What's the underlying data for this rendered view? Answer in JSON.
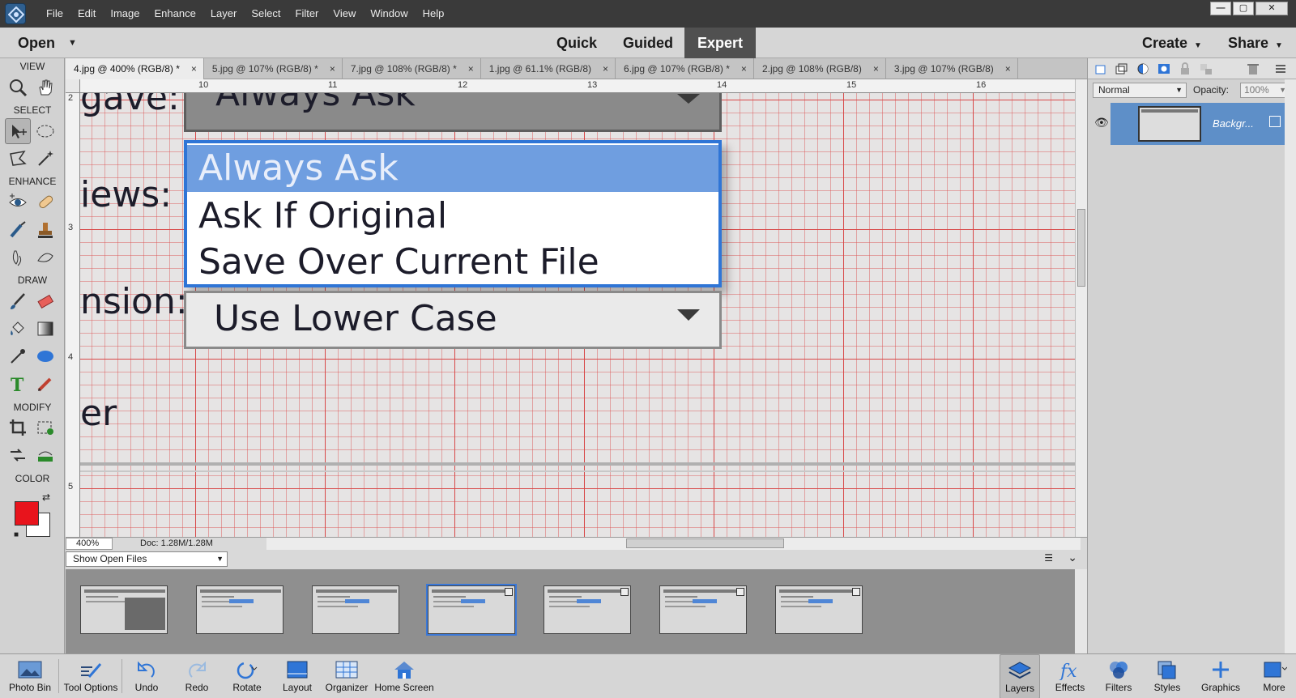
{
  "menubar": {
    "menus": [
      "File",
      "Edit",
      "Image",
      "Enhance",
      "Layer",
      "Select",
      "Filter",
      "View",
      "Window",
      "Help"
    ],
    "window_controls": [
      "—",
      "▢",
      "✕"
    ]
  },
  "modebar": {
    "open_label": "Open",
    "modes": [
      "Quick",
      "Guided",
      "Expert"
    ],
    "active_mode": "Expert",
    "create_label": "Create",
    "share_label": "Share"
  },
  "toolbox": {
    "sections": [
      "VIEW",
      "SELECT",
      "ENHANCE",
      "DRAW",
      "MODIFY",
      "COLOR"
    ],
    "foreground_color": "#e8141c",
    "background_color": "#ffffff"
  },
  "tabs": [
    {
      "label": "4.jpg @ 400% (RGB/8) *",
      "active": true
    },
    {
      "label": "5.jpg @ 107% (RGB/8) *",
      "active": false
    },
    {
      "label": "7.jpg @ 108% (RGB/8) *",
      "active": false
    },
    {
      "label": "1.jpg @ 61.1% (RGB/8)",
      "active": false
    },
    {
      "label": "6.jpg @ 107% (RGB/8) *",
      "active": false
    },
    {
      "label": "2.jpg @ 108% (RGB/8)",
      "active": false
    },
    {
      "label": "3.jpg @ 107% (RGB/8)",
      "active": false
    }
  ],
  "ruler": {
    "top_numbers": [
      "10",
      "11",
      "12",
      "13",
      "14",
      "15",
      "16"
    ],
    "left_numbers": [
      "2",
      "3",
      "4",
      "5"
    ]
  },
  "canvas": {
    "fragments": [
      "gave:",
      "iews:",
      "nsion:",
      "er"
    ],
    "combo_top_value": "Always Ask",
    "dropdown_items": [
      "Always Ask",
      "Ask If Original",
      "Save Over Current File"
    ],
    "combo_bottom_value": "Use Lower Case"
  },
  "status": {
    "zoom": "400%",
    "doc_info": "Doc: 1.28M/1.28M"
  },
  "photo_bin": {
    "show_label": "Show Open Files",
    "thumb_count": 7,
    "selected_index": 3
  },
  "layers_panel": {
    "blend_mode": "Normal",
    "opacity_label": "Opacity:",
    "opacity_value": "100%",
    "layer_name": "Backgr..."
  },
  "taskbar": {
    "left": [
      "Photo Bin",
      "Tool Options",
      "Undo",
      "Redo",
      "Rotate",
      "Layout",
      "Organizer",
      "Home Screen"
    ],
    "right": [
      "Layers",
      "Effects",
      "Filters",
      "Styles",
      "Graphics",
      "More"
    ]
  },
  "colors": {
    "accent_blue": "#2f75d6",
    "highlight_blue": "#6f9ee0",
    "grid_red": "#d84848"
  }
}
